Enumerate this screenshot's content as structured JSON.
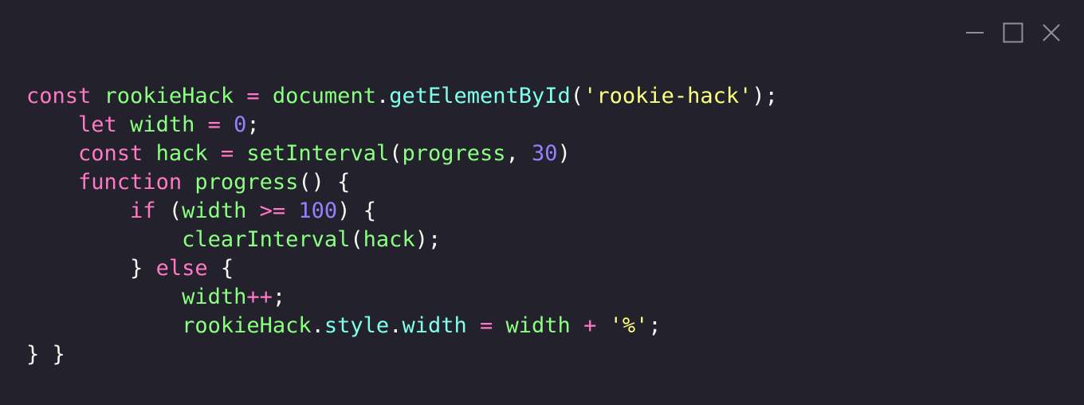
{
  "window": {
    "controls": [
      {
        "name": "minimize-icon"
      },
      {
        "name": "maximize-icon"
      },
      {
        "name": "close-icon"
      }
    ]
  },
  "colors": {
    "background": "#22212c",
    "keyword": "#ff79c6",
    "identifier": "#8aff80",
    "property": "#80ffea",
    "number": "#9580ff",
    "string": "#ffff80",
    "punctuation": "#f8f8f2",
    "icon": "#8f8e99"
  },
  "code": {
    "lines": [
      [
        [
          "kw",
          "const"
        ],
        [
          "pn",
          " "
        ],
        [
          "id",
          "rookieHack"
        ],
        [
          "pn",
          " "
        ],
        [
          "op",
          "="
        ],
        [
          "pn",
          " "
        ],
        [
          "id",
          "document"
        ],
        [
          "pn",
          "."
        ],
        [
          "prop",
          "getElementById"
        ],
        [
          "pn",
          "("
        ],
        [
          "str",
          "'rookie-hack'"
        ],
        [
          "pn",
          ");"
        ]
      ],
      [
        [
          "pn",
          "    "
        ],
        [
          "kw",
          "let"
        ],
        [
          "pn",
          " "
        ],
        [
          "id",
          "width"
        ],
        [
          "pn",
          " "
        ],
        [
          "op",
          "="
        ],
        [
          "pn",
          " "
        ],
        [
          "num",
          "0"
        ],
        [
          "pn",
          ";"
        ]
      ],
      [
        [
          "pn",
          "    "
        ],
        [
          "kw",
          "const"
        ],
        [
          "pn",
          " "
        ],
        [
          "id",
          "hack"
        ],
        [
          "pn",
          " "
        ],
        [
          "op",
          "="
        ],
        [
          "pn",
          " "
        ],
        [
          "fn",
          "setInterval"
        ],
        [
          "pn",
          "("
        ],
        [
          "id",
          "progress"
        ],
        [
          "pn",
          ", "
        ],
        [
          "num",
          "30"
        ],
        [
          "pn",
          ")"
        ]
      ],
      [
        [
          "pn",
          "    "
        ],
        [
          "kw",
          "function"
        ],
        [
          "pn",
          " "
        ],
        [
          "fn",
          "progress"
        ],
        [
          "pn",
          "() {"
        ]
      ],
      [
        [
          "pn",
          "        "
        ],
        [
          "kw",
          "if"
        ],
        [
          "pn",
          " ("
        ],
        [
          "id",
          "width"
        ],
        [
          "pn",
          " "
        ],
        [
          "op",
          ">="
        ],
        [
          "pn",
          " "
        ],
        [
          "num",
          "100"
        ],
        [
          "pn",
          ") {"
        ]
      ],
      [
        [
          "pn",
          "            "
        ],
        [
          "fn",
          "clearInterval"
        ],
        [
          "pn",
          "("
        ],
        [
          "id",
          "hack"
        ],
        [
          "pn",
          ");"
        ]
      ],
      [
        [
          "pn",
          "        } "
        ],
        [
          "kw",
          "else"
        ],
        [
          "pn",
          " {"
        ]
      ],
      [
        [
          "pn",
          "            "
        ],
        [
          "id",
          "width"
        ],
        [
          "op",
          "++"
        ],
        [
          "pn",
          ";"
        ]
      ],
      [
        [
          "pn",
          "            "
        ],
        [
          "id",
          "rookieHack"
        ],
        [
          "pn",
          "."
        ],
        [
          "prop",
          "style"
        ],
        [
          "pn",
          "."
        ],
        [
          "prop",
          "width"
        ],
        [
          "pn",
          " "
        ],
        [
          "op",
          "="
        ],
        [
          "pn",
          " "
        ],
        [
          "id",
          "width"
        ],
        [
          "pn",
          " "
        ],
        [
          "op",
          "+"
        ],
        [
          "pn",
          " "
        ],
        [
          "str",
          "'%'"
        ],
        [
          "pn",
          ";"
        ]
      ],
      [
        [
          "pn",
          "} }"
        ]
      ]
    ]
  }
}
